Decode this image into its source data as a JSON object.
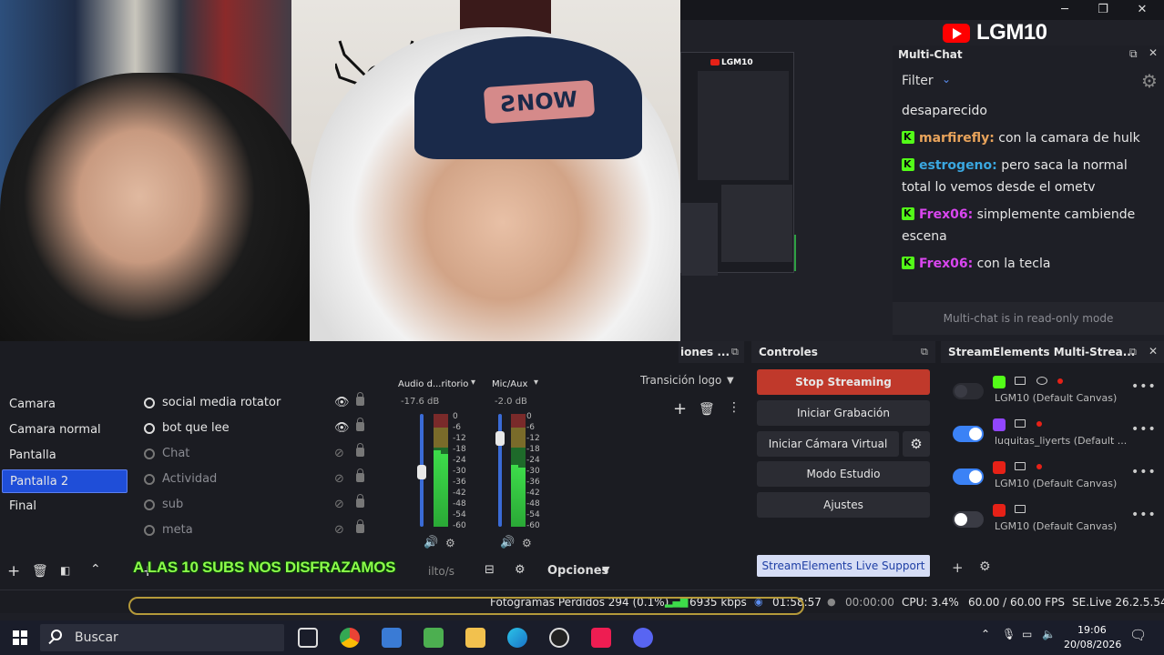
{
  "window": {
    "minimize": "─",
    "maximize": "❐",
    "close": "✕"
  },
  "channel": {
    "name": "LGM10"
  },
  "preview": {
    "mini_title": "LGM10"
  },
  "multichat": {
    "title": "Multi-Chat",
    "filter_label": "Filter",
    "messages": [
      {
        "user": "",
        "text": "desaparecido",
        "color": "#e6e6e6"
      },
      {
        "user": "marfirefly",
        "text": " con la camara de hulk",
        "color": "#e8a35b"
      },
      {
        "user": "estrogeno",
        "text": " pero saca la normal total lo vemos desde el ometv",
        "color": "#3aa7e0"
      },
      {
        "user": "Frex06",
        "text": " simplemente cambiende escena",
        "color": "#d946ef"
      },
      {
        "user": "Frex06",
        "text": " con la tecla",
        "color": "#d946ef"
      }
    ],
    "readonly_note": "Multi-chat is in read-only mode"
  },
  "scenes": {
    "items": [
      "Camara",
      "Camara normal",
      "Pantalla",
      "Pantalla 2",
      "Final"
    ],
    "active_index": 3
  },
  "sources": {
    "items": [
      {
        "name": "social media rotator",
        "visible": true
      },
      {
        "name": "bot que lee",
        "visible": true
      },
      {
        "name": "Chat",
        "visible": false
      },
      {
        "name": "Actividad",
        "visible": false
      },
      {
        "name": "sub",
        "visible": false
      },
      {
        "name": "meta",
        "visible": false
      }
    ]
  },
  "mixer": {
    "channels": [
      {
        "name": "Audio d...ritorio",
        "db": "-17.6 dB",
        "level": 0.68
      },
      {
        "name": "Mic/Aux",
        "db": "-2.0 dB",
        "level": 0.55
      }
    ],
    "scale": [
      "0",
      "-6",
      "-12",
      "-18",
      "-24",
      "-30",
      "-36",
      "-42",
      "-48",
      "-54",
      "-60"
    ],
    "footer_label": "ilto/s"
  },
  "transitions": {
    "header": "iones ...",
    "selected": "Transición logo"
  },
  "controls": {
    "header": "Controles",
    "stop_streaming": "Stop Streaming",
    "start_recording": "Iniciar Grabación",
    "start_virtual_cam": "Iniciar Cámara Virtual",
    "studio_mode": "Modo Estudio",
    "settings": "Ajustes",
    "options": "Opciones",
    "live_support": "StreamElements Live Support"
  },
  "streamelements": {
    "title": "StreamElements Multi-Strea...",
    "outputs": [
      {
        "platform": "kick",
        "enabled": null,
        "name": "LGM10 (Default Canvas)"
      },
      {
        "platform": "twitch",
        "enabled": true,
        "name": "luquitas_liyerts (Default ..."
      },
      {
        "platform": "youtube",
        "enabled": true,
        "name": "LGM10 (Default Canvas)"
      },
      {
        "platform": "youtube",
        "enabled": false,
        "name": "LGM10 (Default Canvas)"
      }
    ]
  },
  "overlay": {
    "text": "A LAS 10 SUBS NOS DISFRAZAMOS"
  },
  "status": {
    "dropped_frames": "Fotogramas Perdidos 294 (0.1%)",
    "bitrate": "6935 kbps",
    "stream_time": "01:58:57",
    "rec_time": "00:00:00",
    "cpu": "CPU: 3.4%",
    "fps": "60.00 / 60.00 FPS",
    "version": "SE.Live 26.2.5.549"
  },
  "taskbar": {
    "search_placeholder": "Buscar",
    "time": "19:06",
    "date": "20/08/2026"
  },
  "colors": {
    "accent_blue": "#1f4ed8",
    "stop_red": "#c0392b",
    "kick_green": "#53fc18",
    "youtube_red": "#e62117",
    "twitch_purple": "#9146ff"
  }
}
